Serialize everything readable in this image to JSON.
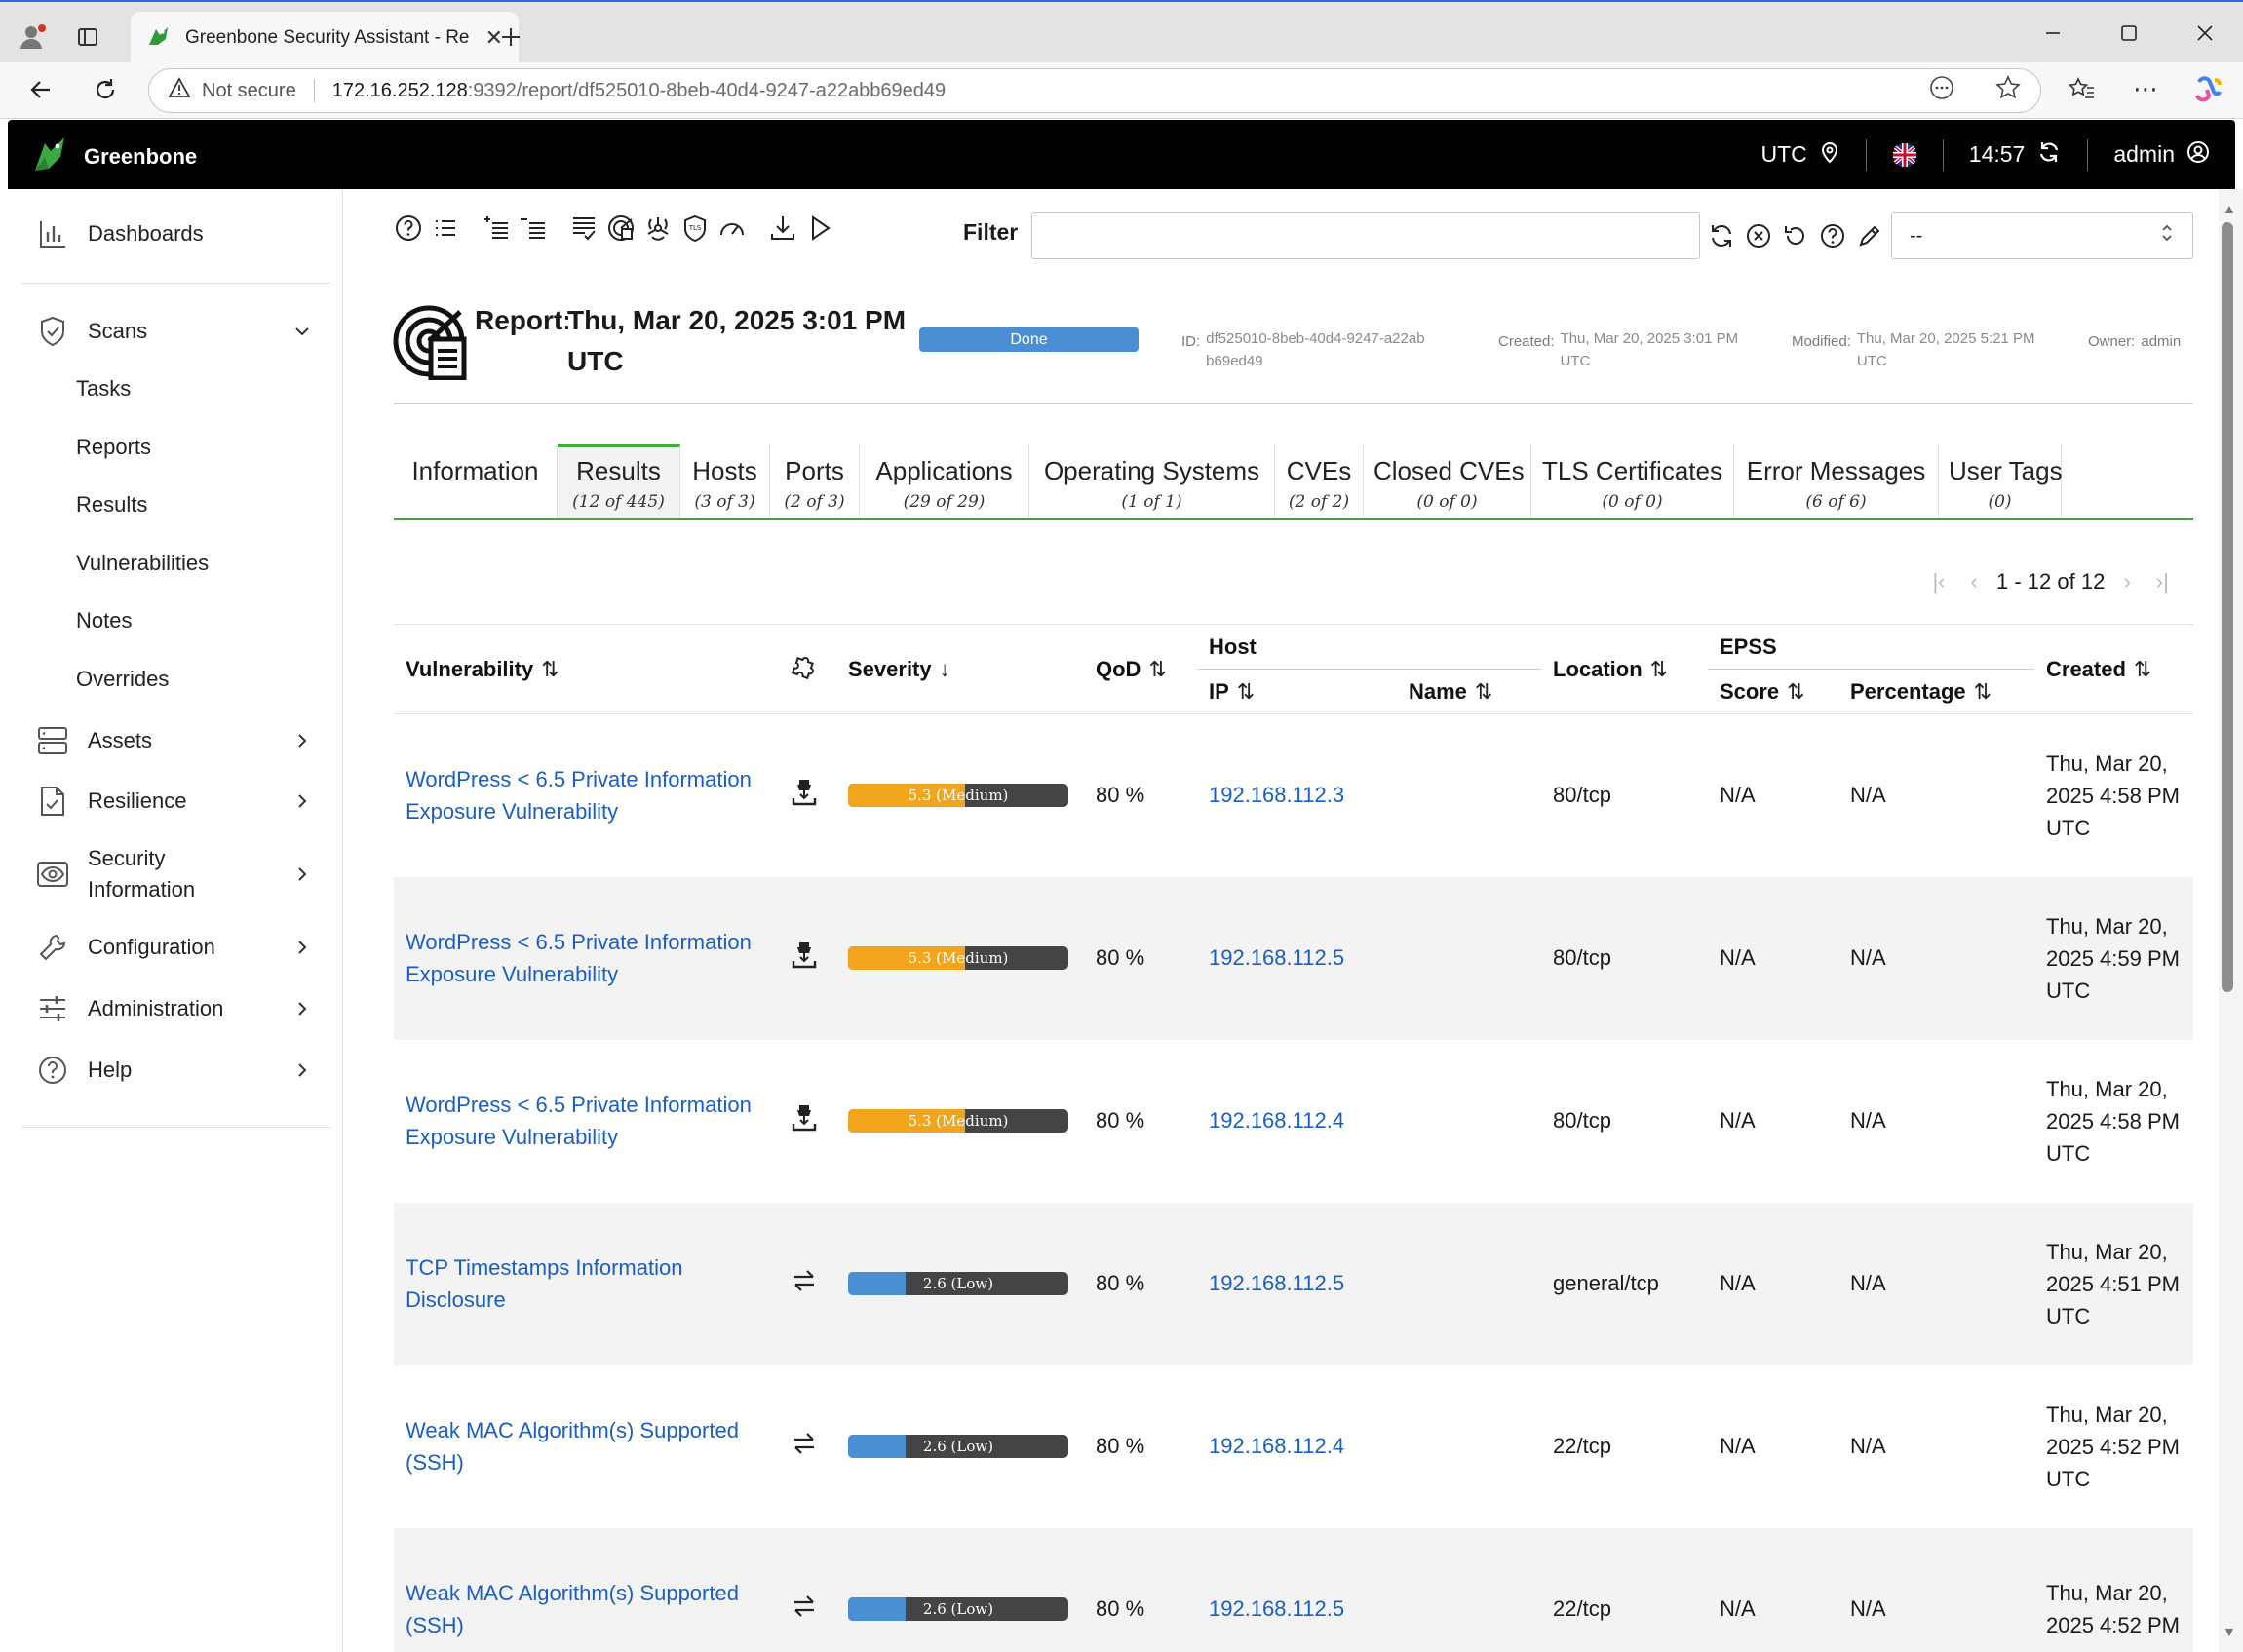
{
  "browser": {
    "tab_title": "Greenbone Security Assistant - Re",
    "security_label": "Not secure",
    "url_host": "172.16.252.128",
    "url_path": ":9392/report/df525010-8beb-40d4-9247-a22abb69ed49"
  },
  "header": {
    "brand": "Greenbone",
    "timezone": "UTC",
    "time": "14:57",
    "user": "admin"
  },
  "sidebar": {
    "dashboards": "Dashboards",
    "scans": "Scans",
    "scans_children": [
      "Tasks",
      "Reports",
      "Results",
      "Vulnerabilities",
      "Notes",
      "Overrides"
    ],
    "assets": "Assets",
    "resilience": "Resilience",
    "security_information": "Security Information",
    "configuration": "Configuration",
    "administration": "Administration",
    "help": "Help"
  },
  "filter": {
    "label": "Filter",
    "value": "",
    "select_value": "--"
  },
  "report": {
    "title_prefix": "Report:",
    "title_date": "Thu, Mar 20, 2025 3:01 PM UTC",
    "status": "Done",
    "id_label": "ID:",
    "id_value": "df525010-8beb-40d4-9247-a22abb69ed49",
    "created_label": "Created:",
    "created_value": "Thu, Mar 20, 2025 3:01 PM UTC",
    "modified_label": "Modified:",
    "modified_value": "Thu, Mar 20, 2025 5:21 PM UTC",
    "owner_label": "Owner:",
    "owner_value": "admin"
  },
  "tabs": [
    {
      "label": "Information",
      "count": ""
    },
    {
      "label": "Results",
      "count": "(12 of 445)"
    },
    {
      "label": "Hosts",
      "count": "(3 of 3)"
    },
    {
      "label": "Ports",
      "count": "(2 of 3)"
    },
    {
      "label": "Applications",
      "count": "(29 of 29)"
    },
    {
      "label": "Operating Systems",
      "count": "(1 of 1)"
    },
    {
      "label": "CVEs",
      "count": "(2 of 2)"
    },
    {
      "label": "Closed CVEs",
      "count": "(0 of 0)"
    },
    {
      "label": "TLS Certificates",
      "count": "(0 of 0)"
    },
    {
      "label": "Error Messages",
      "count": "(6 of 6)"
    },
    {
      "label": "User Tags",
      "count": "(0)"
    }
  ],
  "pagination": {
    "text": "1 - 12 of 12"
  },
  "table": {
    "headers": {
      "vulnerability": "Vulnerability",
      "severity": "Severity",
      "qod": "QoD",
      "host": "Host",
      "ip": "IP",
      "name": "Name",
      "location": "Location",
      "epss": "EPSS",
      "score": "Score",
      "percentage": "Percentage",
      "created": "Created"
    },
    "rows": [
      {
        "vulnerability": "WordPress < 6.5 Private Information Exposure Vulnerability",
        "solution_icon": "vendorfix-icon",
        "severity_score": 5.3,
        "severity_label": "5.3 (Medium)",
        "severity_color": "#f0a51c",
        "qod": "80 %",
        "ip": "192.168.112.3",
        "name": "",
        "location": "80/tcp",
        "epss_score": "N/A",
        "epss_percentage": "N/A",
        "created": "Thu, Mar 20, 2025 4:58 PM UTC"
      },
      {
        "vulnerability": "WordPress < 6.5 Private Information Exposure Vulnerability",
        "solution_icon": "vendorfix-icon",
        "severity_score": 5.3,
        "severity_label": "5.3 (Medium)",
        "severity_color": "#f0a51c",
        "qod": "80 %",
        "ip": "192.168.112.5",
        "name": "",
        "location": "80/tcp",
        "epss_score": "N/A",
        "epss_percentage": "N/A",
        "created": "Thu, Mar 20, 2025 4:59 PM UTC"
      },
      {
        "vulnerability": "WordPress < 6.5 Private Information Exposure Vulnerability",
        "solution_icon": "vendorfix-icon",
        "severity_score": 5.3,
        "severity_label": "5.3 (Medium)",
        "severity_color": "#f0a51c",
        "qod": "80 %",
        "ip": "192.168.112.4",
        "name": "",
        "location": "80/tcp",
        "epss_score": "N/A",
        "epss_percentage": "N/A",
        "created": "Thu, Mar 20, 2025 4:58 PM UTC"
      },
      {
        "vulnerability": "TCP Timestamps Information Disclosure",
        "solution_icon": "mitigation-icon",
        "severity_score": 2.6,
        "severity_label": "2.6 (Low)",
        "severity_color": "#4a8fd4",
        "qod": "80 %",
        "ip": "192.168.112.5",
        "name": "",
        "location": "general/tcp",
        "epss_score": "N/A",
        "epss_percentage": "N/A",
        "created": "Thu, Mar 20, 2025 4:51 PM UTC"
      },
      {
        "vulnerability": "Weak MAC Algorithm(s) Supported (SSH)",
        "solution_icon": "mitigation-icon",
        "severity_score": 2.6,
        "severity_label": "2.6 (Low)",
        "severity_color": "#4a8fd4",
        "qod": "80 %",
        "ip": "192.168.112.4",
        "name": "",
        "location": "22/tcp",
        "epss_score": "N/A",
        "epss_percentage": "N/A",
        "created": "Thu, Mar 20, 2025 4:52 PM UTC"
      },
      {
        "vulnerability": "Weak MAC Algorithm(s) Supported (SSH)",
        "solution_icon": "mitigation-icon",
        "severity_score": 2.6,
        "severity_label": "2.6 (Low)",
        "severity_color": "#4a8fd4",
        "qod": "80 %",
        "ip": "192.168.112.5",
        "name": "",
        "location": "22/tcp",
        "epss_score": "N/A",
        "epss_percentage": "N/A",
        "created": "Thu, Mar 20, 2025 4:52 PM"
      }
    ]
  }
}
